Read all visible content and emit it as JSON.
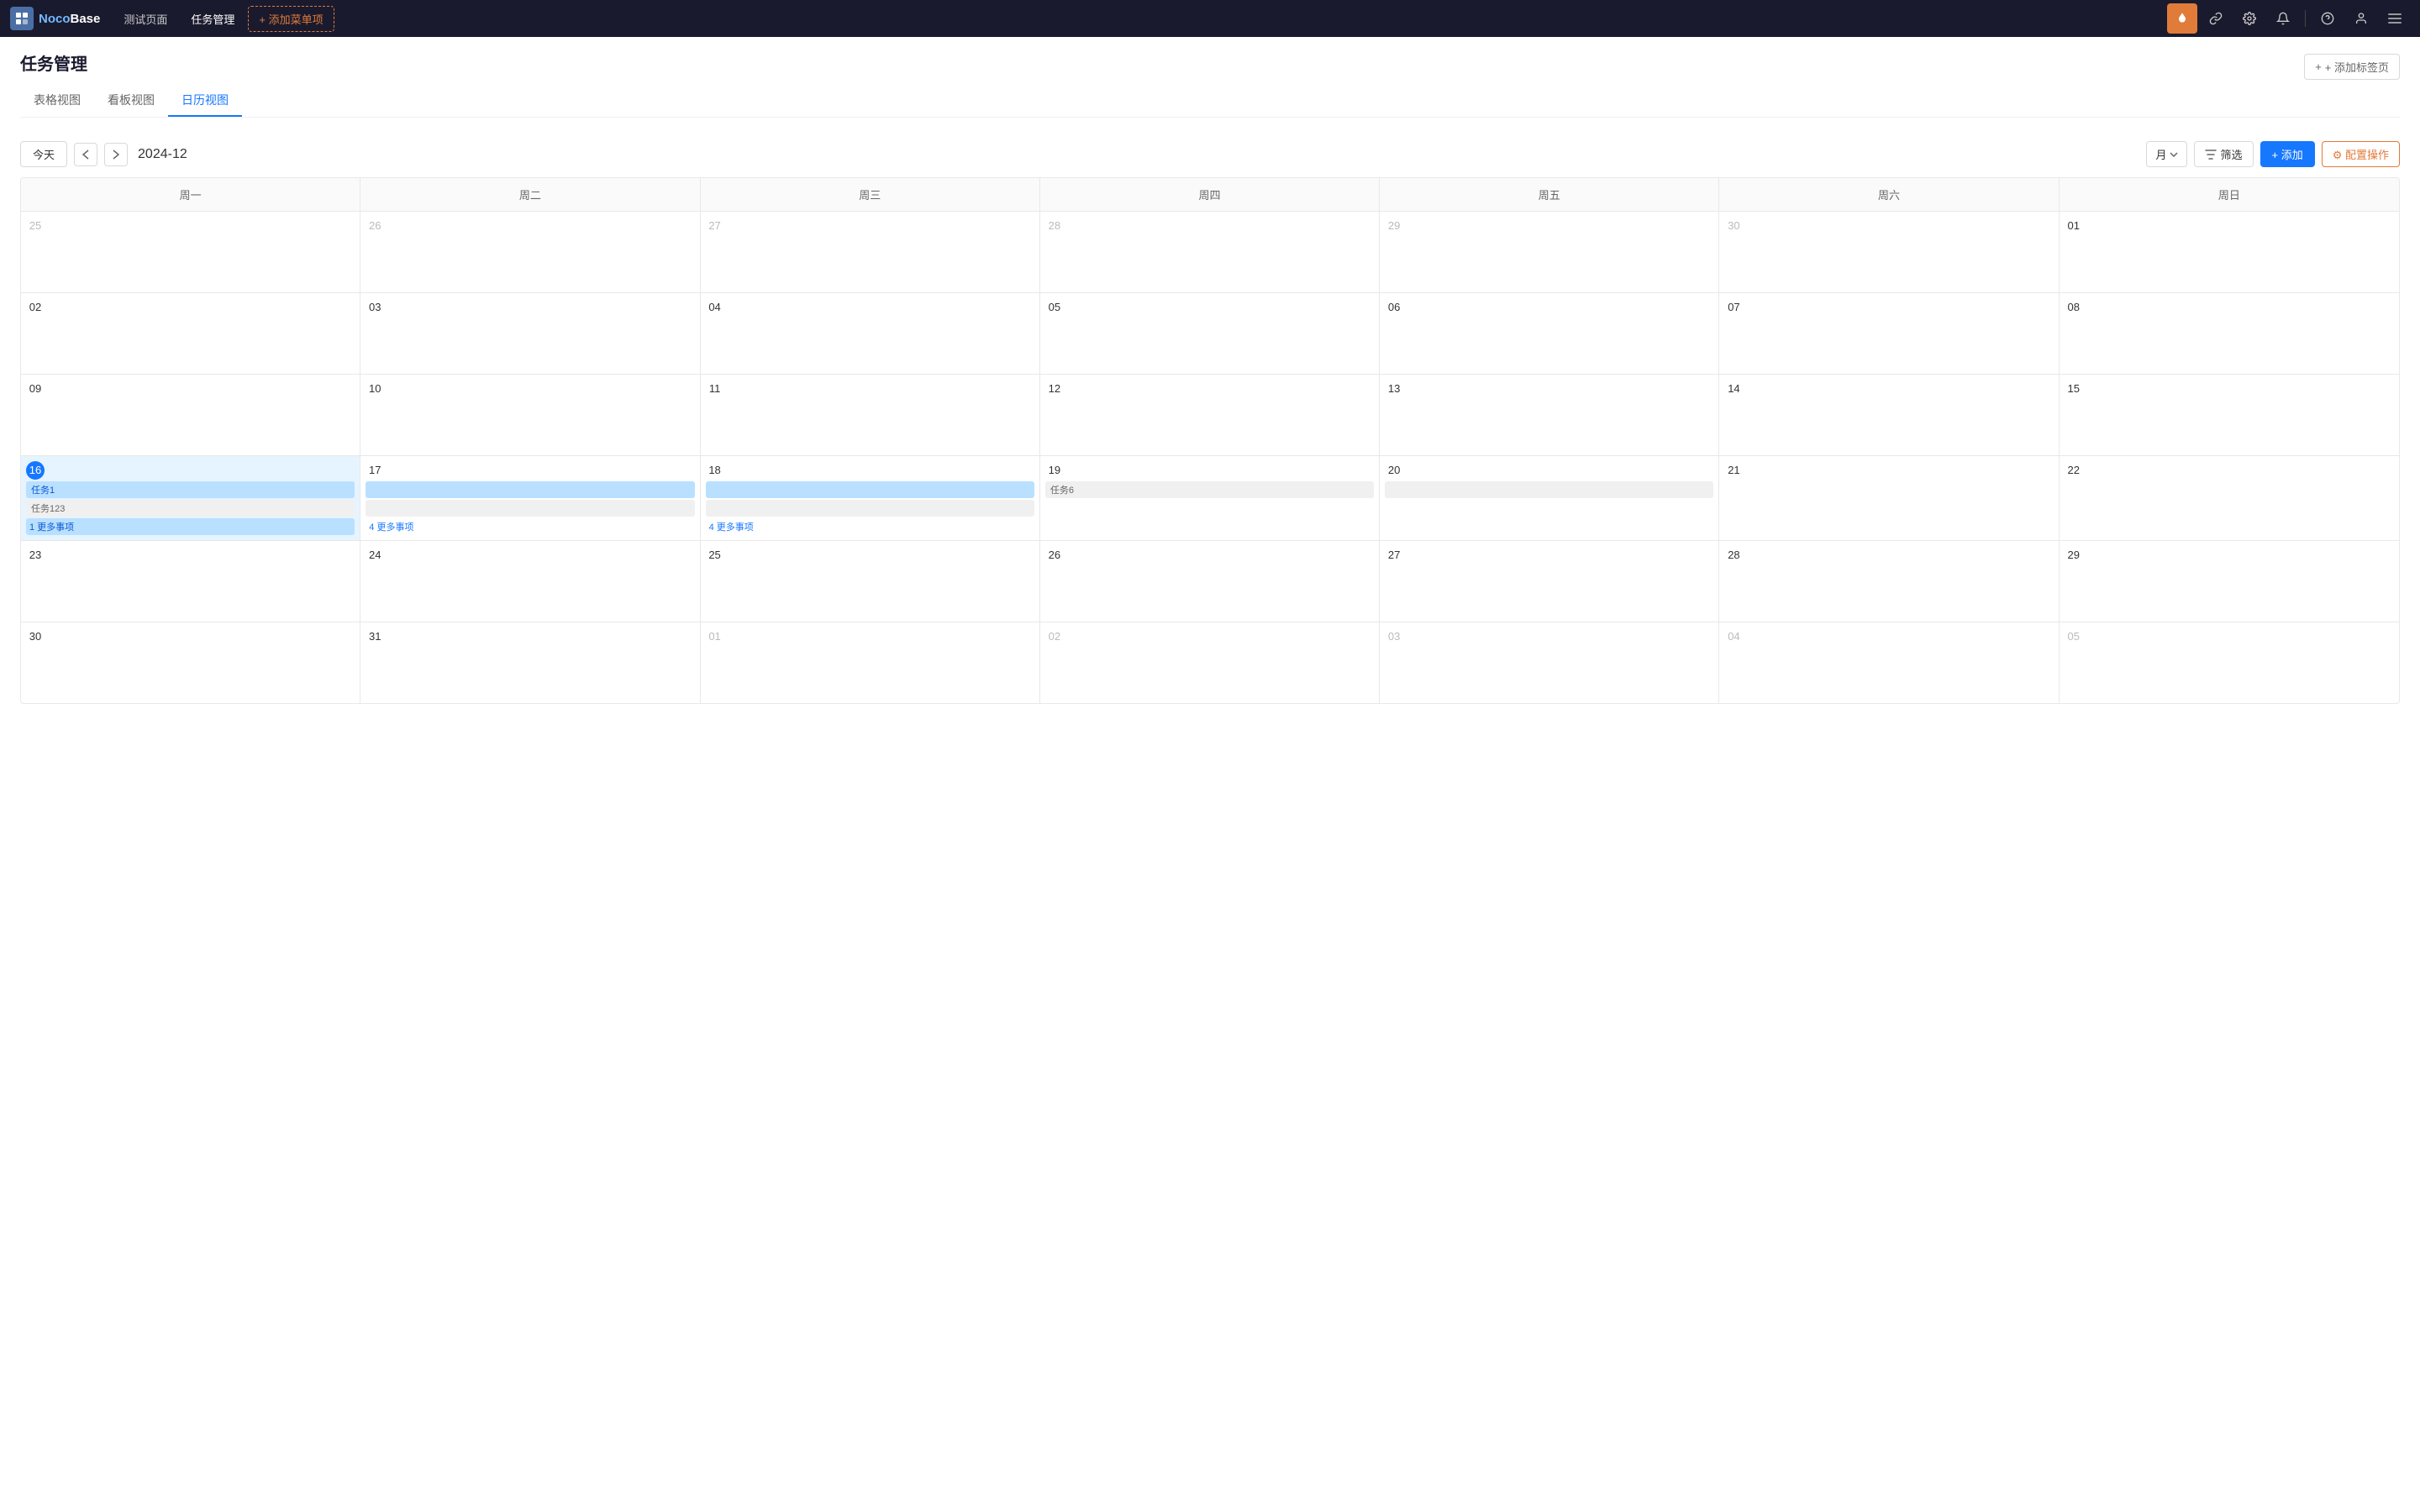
{
  "app": {
    "logo_text1": "Noco",
    "logo_text2": "Base"
  },
  "topnav": {
    "items": [
      {
        "id": "test-page",
        "label": "测试页面",
        "active": false
      },
      {
        "id": "task-mgmt",
        "label": "任务管理",
        "active": true
      }
    ],
    "add_menu_label": "+ 添加菜单项",
    "icons": {
      "fire": "🔥",
      "link": "🔗",
      "settings": "⚙",
      "bell": "🔔",
      "help": "？",
      "user": "👤",
      "menu": "☰"
    }
  },
  "page": {
    "title": "任务管理",
    "tabs": [
      {
        "id": "table",
        "label": "表格视图",
        "active": false
      },
      {
        "id": "kanban",
        "label": "看板视图",
        "active": false
      },
      {
        "id": "calendar",
        "label": "日历视图",
        "active": true
      }
    ],
    "add_tab_label": "+ 添加标签页"
  },
  "toolbar": {
    "today_label": "今天",
    "month_label": "月",
    "filter_label": "筛选",
    "add_label": "+ 添加",
    "config_label": "⚙ 配置操作",
    "current_period": "2024-12"
  },
  "calendar": {
    "weekdays": [
      "周一",
      "周二",
      "周三",
      "周四",
      "周五",
      "周六",
      "周日"
    ],
    "rows": [
      {
        "cells": [
          {
            "date": "25",
            "other_month": true,
            "today": false
          },
          {
            "date": "26",
            "other_month": true,
            "today": false
          },
          {
            "date": "27",
            "other_month": true,
            "today": false
          },
          {
            "date": "28",
            "other_month": true,
            "today": false
          },
          {
            "date": "29",
            "other_month": true,
            "today": false
          },
          {
            "date": "30",
            "other_month": true,
            "today": false
          },
          {
            "date": "01",
            "other_month": false,
            "today": false
          }
        ]
      },
      {
        "cells": [
          {
            "date": "02",
            "other_month": false,
            "today": false
          },
          {
            "date": "03",
            "other_month": false,
            "today": false
          },
          {
            "date": "04",
            "other_month": false,
            "today": false
          },
          {
            "date": "05",
            "other_month": false,
            "today": false
          },
          {
            "date": "06",
            "other_month": false,
            "today": false
          },
          {
            "date": "07",
            "other_month": false,
            "today": false
          },
          {
            "date": "08",
            "other_month": false,
            "today": false
          }
        ]
      },
      {
        "cells": [
          {
            "date": "09",
            "other_month": false,
            "today": false
          },
          {
            "date": "10",
            "other_month": false,
            "today": false
          },
          {
            "date": "11",
            "other_month": false,
            "today": false
          },
          {
            "date": "12",
            "other_month": false,
            "today": false
          },
          {
            "date": "13",
            "other_month": false,
            "today": false
          },
          {
            "date": "14",
            "other_month": false,
            "today": false
          },
          {
            "date": "15",
            "other_month": false,
            "today": false
          }
        ]
      },
      {
        "cells": [
          {
            "date": "16",
            "other_month": false,
            "today": true
          },
          {
            "date": "17",
            "other_month": false,
            "today": false
          },
          {
            "date": "18",
            "other_month": false,
            "today": false
          },
          {
            "date": "19",
            "other_month": false,
            "today": false
          },
          {
            "date": "20",
            "other_month": false,
            "today": false
          },
          {
            "date": "21",
            "other_month": false,
            "today": false
          },
          {
            "date": "22",
            "other_month": false,
            "today": false
          }
        ]
      },
      {
        "cells": [
          {
            "date": "23",
            "other_month": false,
            "today": false
          },
          {
            "date": "24",
            "other_month": false,
            "today": false
          },
          {
            "date": "25",
            "other_month": false,
            "today": false
          },
          {
            "date": "26",
            "other_month": false,
            "today": false
          },
          {
            "date": "27",
            "other_month": false,
            "today": false
          },
          {
            "date": "28",
            "other_month": false,
            "today": false
          },
          {
            "date": "29",
            "other_month": false,
            "today": false
          }
        ]
      },
      {
        "cells": [
          {
            "date": "30",
            "other_month": false,
            "today": false
          },
          {
            "date": "31",
            "other_month": false,
            "today": false
          },
          {
            "date": "01",
            "other_month": true,
            "today": false
          },
          {
            "date": "02",
            "other_month": true,
            "today": false
          },
          {
            "date": "03",
            "other_month": true,
            "today": false
          },
          {
            "date": "04",
            "other_month": true,
            "today": false
          },
          {
            "date": "05",
            "other_month": true,
            "today": false
          }
        ]
      }
    ],
    "events": {
      "row3": {
        "task1_label": "任务1",
        "task123_label": "任务123",
        "task6_label": "任务6",
        "more1_label": "1 更多事项",
        "more4a_label": "4 更多事项",
        "more4b_label": "4 更多事项"
      }
    }
  }
}
